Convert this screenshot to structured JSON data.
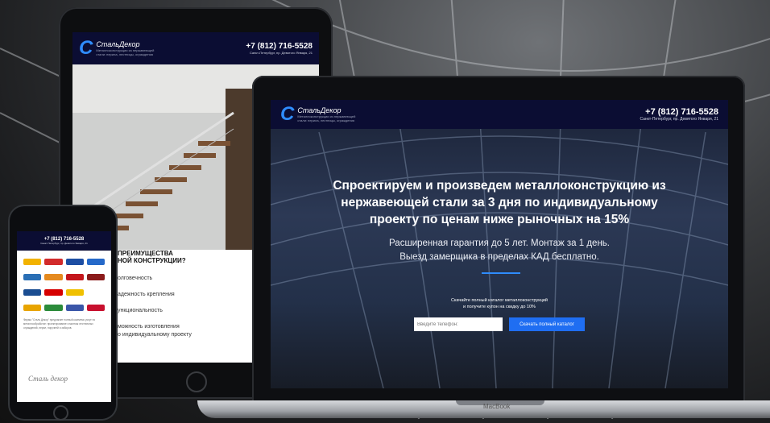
{
  "brand": {
    "name": "СтальДекор",
    "logo_letter": "С",
    "tagline_line1": "Металлоконструкции из нержавеющей",
    "tagline_line2": "стали: перила, лестницы, ограждения"
  },
  "contact": {
    "phone": "+7 (812) 716-5528",
    "address": "Санкт-Петербург, пр. Девятого Января, 21"
  },
  "laptop": {
    "headline_lines": [
      "Спроектируем и произведем металлоконструкцию из",
      "нержавеющей стали за 3 дня по индивидуальному",
      "проекту по ценам ниже рыночных на 15%"
    ],
    "sub_lines": [
      "Расширенная гарантия до 5 лет. Монтаж за 1 день.",
      "Выезд замерщика в пределах КАД бесплатно."
    ],
    "catalog_line1": "Скачайте полный каталог металлоконструкций",
    "catalog_line2": "и получите купон на скидку до 10%",
    "phone_placeholder": "Введите телефон:",
    "cta_label": "Скачать полный каталог",
    "model_label": "MacBook"
  },
  "tablet": {
    "section_title_line1": "ПРЕИМУЩЕСТВА",
    "section_title_line2": "НОЙ КОНСТРУКЦИИ?",
    "benefits": [
      "олговечность",
      "адежность крепления",
      "ункциональность",
      "можность изготовления",
      "о индивидуальному проекту"
    ]
  },
  "phone": {
    "body_text": "Фирма \"Сталь Декор\" предлагает полный комплекс услуг по металлообработке: проектирование и монтаж лестничных ограждений, перил, поручней и заборов.",
    "signature": "Сталь декор"
  },
  "colors": {
    "header_bg": "#0b0d33",
    "accent": "#2f8cff",
    "cta": "#1f6ef2"
  }
}
